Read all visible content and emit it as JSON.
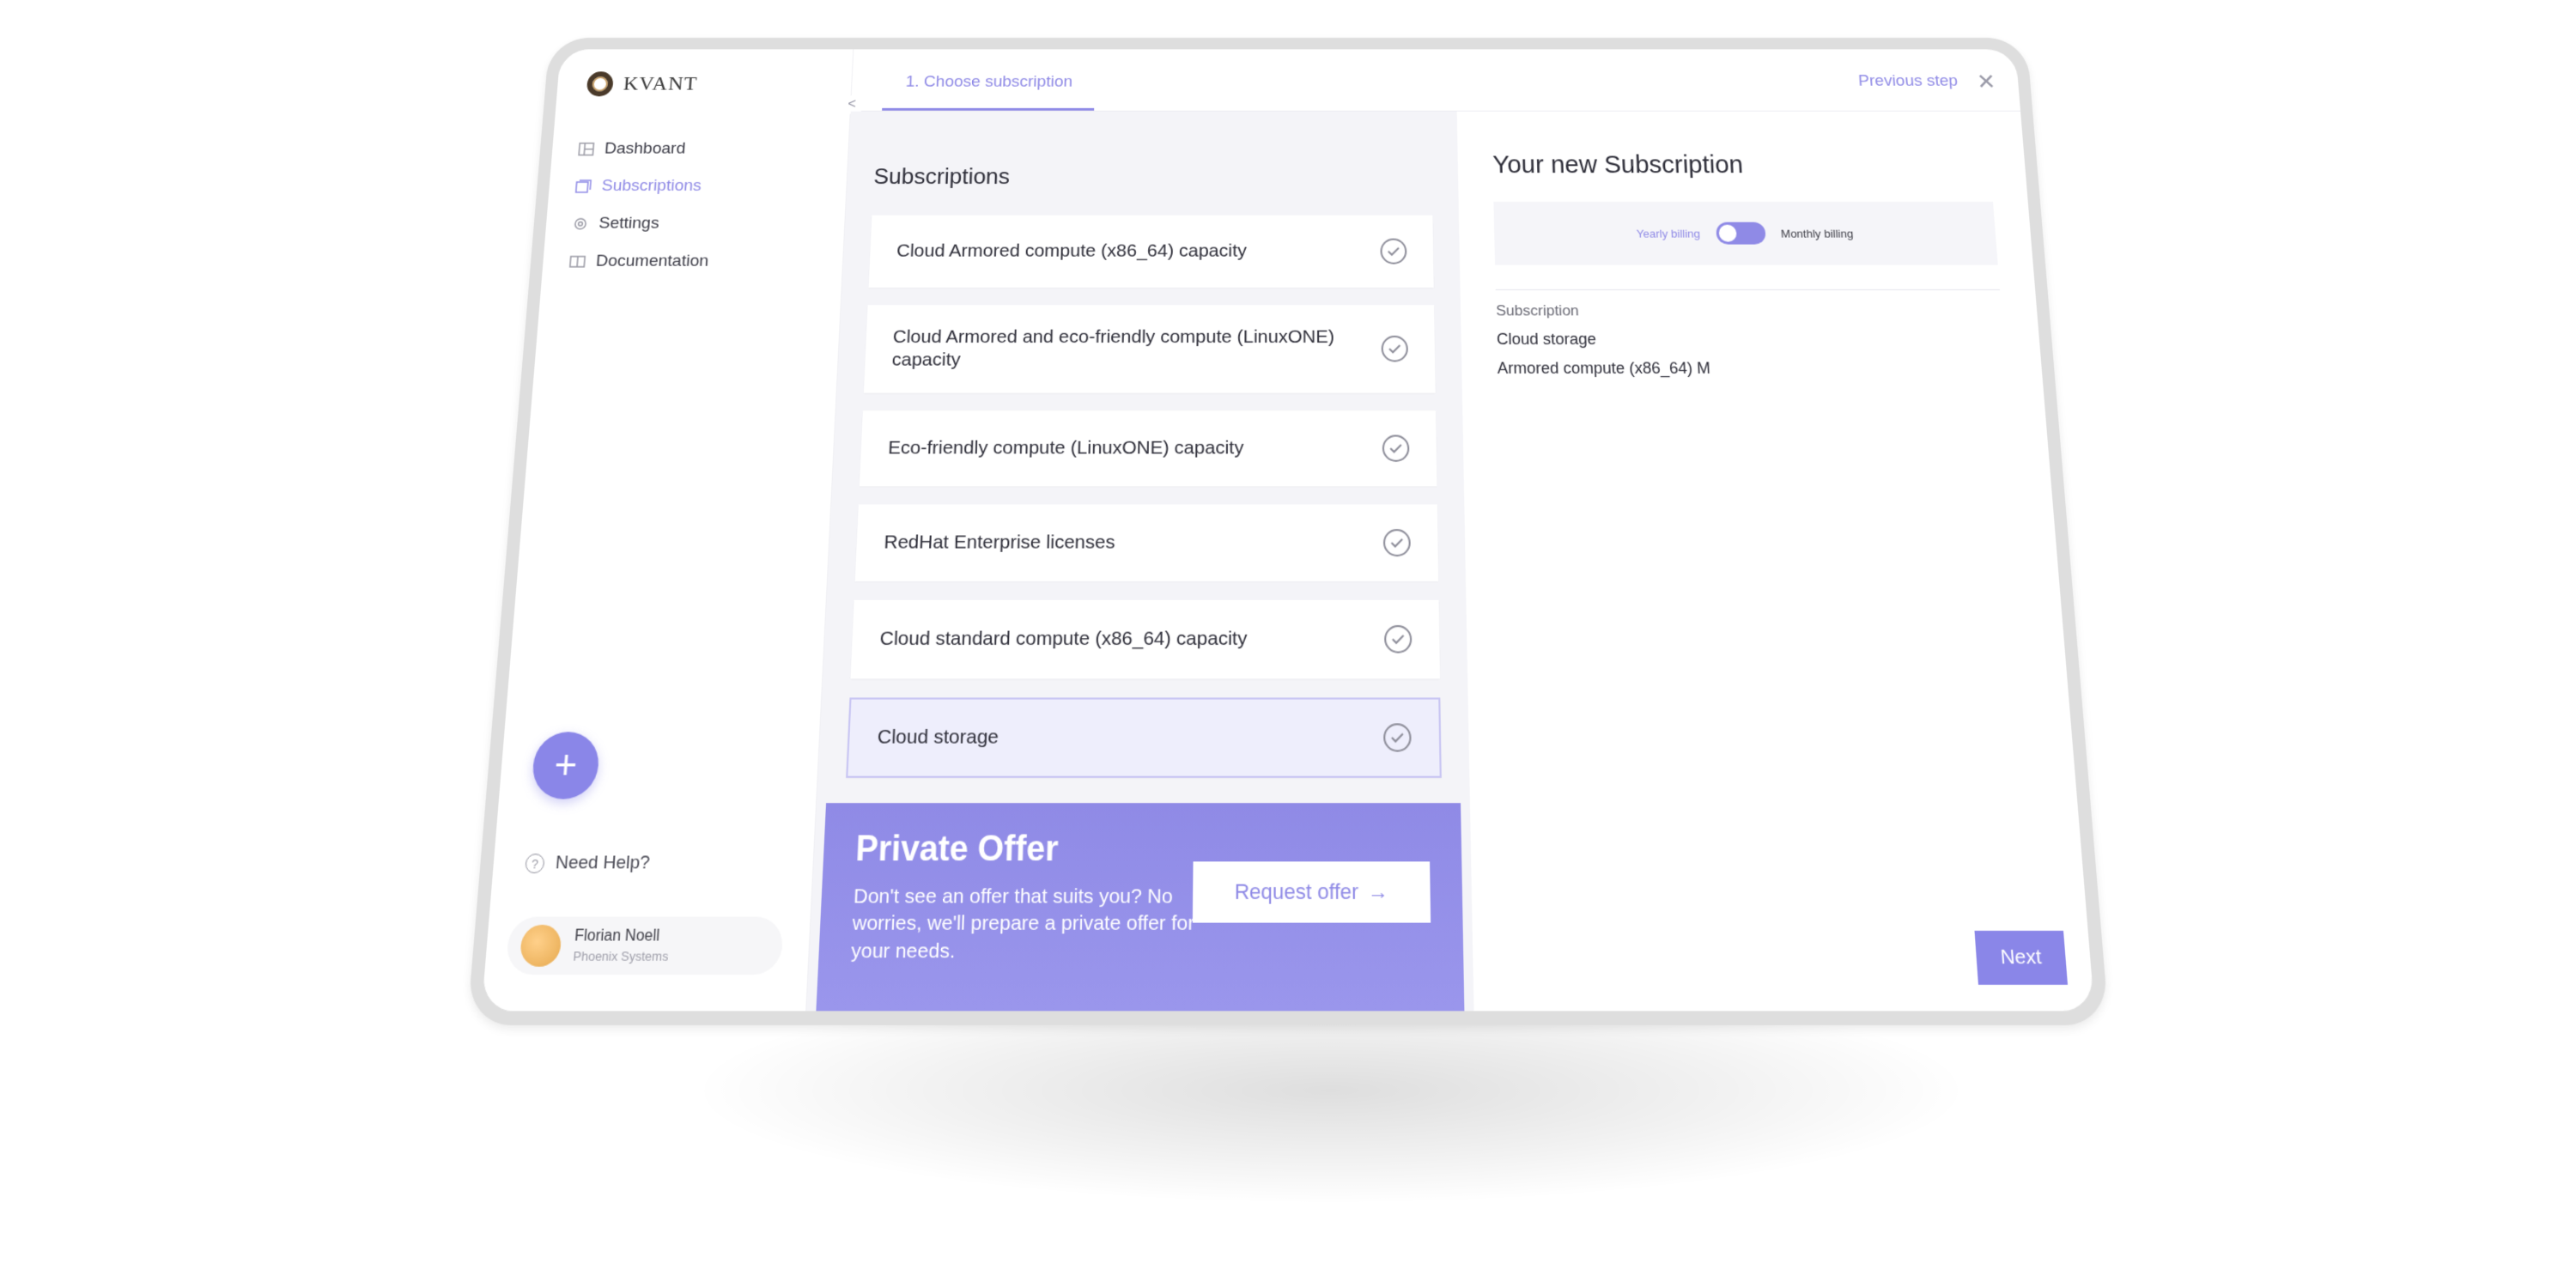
{
  "brand": {
    "name": "KVANT"
  },
  "sidebar": {
    "items": [
      {
        "label": "Dashboard",
        "icon": "dashboard-icon"
      },
      {
        "label": "Subscriptions",
        "icon": "subscriptions-icon",
        "active": true
      },
      {
        "label": "Settings",
        "icon": "gear-icon"
      },
      {
        "label": "Documentation",
        "icon": "book-icon"
      }
    ],
    "help_label": "Need Help?",
    "user": {
      "name": "Florian Noell",
      "org": "Phoenix Systems"
    }
  },
  "header": {
    "step_label": "1. Choose subscription",
    "previous_label": "Previous step"
  },
  "subscriptions": {
    "title": "Subscriptions",
    "items": [
      {
        "label": "Cloud Armored compute (x86_64) capacity"
      },
      {
        "label": "Cloud Armored and eco-friendly compute (LinuxONE) capacity"
      },
      {
        "label": "Eco-friendly compute (LinuxONE) capacity"
      },
      {
        "label": "RedHat Enterprise licenses"
      },
      {
        "label": "Cloud standard compute (x86_64) capacity"
      },
      {
        "label": "Cloud storage",
        "selected": true
      }
    ]
  },
  "offer": {
    "title": "Private Offer",
    "text": "Don't see an offer that suits you? No worries, we'll prepare a private offer for your needs.",
    "button": "Request offer"
  },
  "summary": {
    "title": "Your new Subscription",
    "billing": {
      "yearly": "Yearly billing",
      "monthly": "Monthly billing",
      "selected": "monthly"
    },
    "section_label": "Subscription",
    "items": [
      "Cloud storage",
      "Armored compute (x86_64) M"
    ]
  },
  "actions": {
    "next": "Next"
  },
  "colors": {
    "accent": "#8f8ae6",
    "panel": "#f4f4f8"
  }
}
